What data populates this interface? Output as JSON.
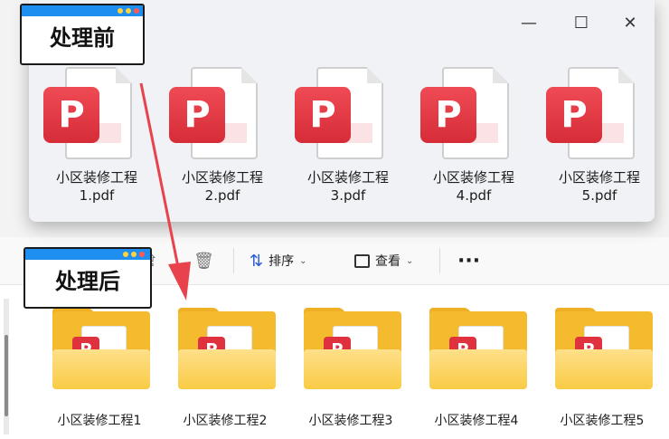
{
  "before_window": {
    "controls": {
      "minimize": "—",
      "maximize": "☐",
      "close": "✕"
    },
    "files": [
      {
        "name_line1": "小区装修工程",
        "name_line2": "1.pdf"
      },
      {
        "name_line1": "小区装修工程",
        "name_line2": "2.pdf"
      },
      {
        "name_line1": "小区装修工程",
        "name_line2": "3.pdf"
      },
      {
        "name_line1": "小区装修工程",
        "name_line2": "4.pdf"
      },
      {
        "name_line1": "小区装修工程",
        "name_line2": "5.pdf"
      }
    ]
  },
  "after_window": {
    "toolbar": {
      "sort_label": "排序",
      "view_label": "查看",
      "more_label": "···"
    },
    "folders": [
      {
        "name": "小区装修工程1"
      },
      {
        "name": "小区装修工程2"
      },
      {
        "name": "小区装修工程3"
      },
      {
        "name": "小区装修工程4"
      },
      {
        "name": "小区装修工程5"
      }
    ]
  },
  "tags": {
    "before": "处理前",
    "after": "处理后"
  },
  "colors": {
    "accent_blue": "#1e8ff0",
    "pdf_red": "#e0313e",
    "folder_yellow": "#f5bb2e",
    "arrow_red": "#e8434d"
  }
}
